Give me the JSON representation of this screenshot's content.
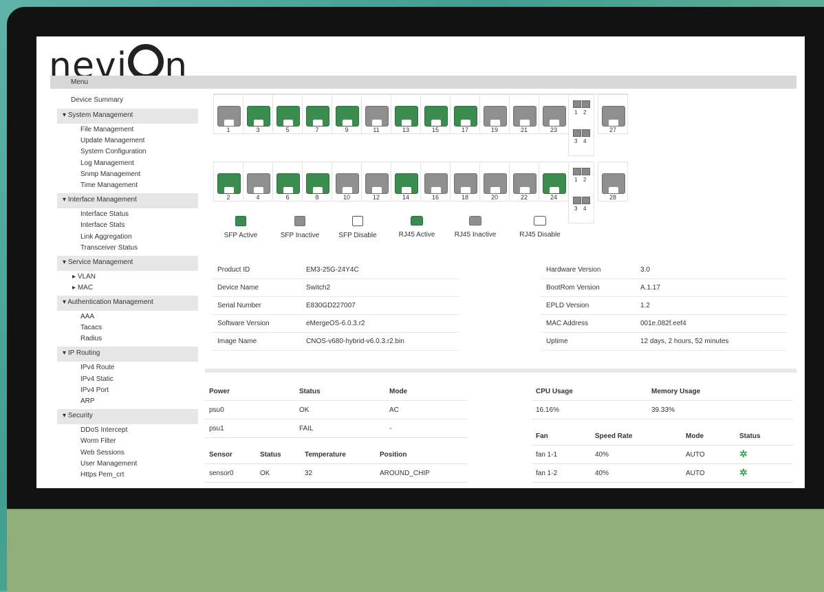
{
  "brand": {
    "logo_pre": "nevi",
    "logo_post": "n",
    "accent": "#3a8c4f",
    "inactive": "#8f8f8f"
  },
  "menu": {
    "label": "Menu"
  },
  "sidebar": {
    "top": "Device Summary",
    "groups": [
      {
        "label": "System Management",
        "items": [
          "File Management",
          "Update Management",
          "System Configuration",
          "Log Management",
          "Snmp Management",
          "Time Management"
        ]
      },
      {
        "label": "Interface Management",
        "items": [
          "Interface Status",
          "Interface Stats",
          "Link Aggregation",
          "Transceiver Status"
        ]
      },
      {
        "label": "Service Management",
        "items": [
          "VLAN",
          "MAC"
        ]
      },
      {
        "label": "Authentication Management",
        "items": [
          "AAA",
          "Tacacs",
          "Radius"
        ]
      },
      {
        "label": "IP Routing",
        "items": [
          "IPv4 Route",
          "IPv4 Static",
          "IPv4 Port",
          "ARP"
        ]
      },
      {
        "label": "Security",
        "items": [
          "DDoS Intercept",
          "Worm Filter",
          "Web Sessions",
          "User Management",
          "Https Pem_crt"
        ]
      }
    ]
  },
  "ports": {
    "top": [
      {
        "n": "1",
        "s": "inactive"
      },
      {
        "n": "3",
        "s": "active"
      },
      {
        "n": "5",
        "s": "active"
      },
      {
        "n": "7",
        "s": "active"
      },
      {
        "n": "9",
        "s": "active"
      },
      {
        "n": "11",
        "s": "inactive"
      },
      {
        "n": "13",
        "s": "active"
      },
      {
        "n": "15",
        "s": "active"
      },
      {
        "n": "17",
        "s": "active"
      },
      {
        "n": "19",
        "s": "inactive"
      },
      {
        "n": "21",
        "s": "inactive"
      },
      {
        "n": "23",
        "s": "inactive"
      }
    ],
    "bottom": [
      {
        "n": "2",
        "s": "active"
      },
      {
        "n": "4",
        "s": "inactive"
      },
      {
        "n": "6",
        "s": "active"
      },
      {
        "n": "8",
        "s": "active"
      },
      {
        "n": "10",
        "s": "inactive"
      },
      {
        "n": "12",
        "s": "inactive"
      },
      {
        "n": "14",
        "s": "active"
      },
      {
        "n": "16",
        "s": "inactive"
      },
      {
        "n": "18",
        "s": "inactive"
      },
      {
        "n": "20",
        "s": "inactive"
      },
      {
        "n": "22",
        "s": "inactive"
      },
      {
        "n": "24",
        "s": "active"
      }
    ],
    "qsfp_labels": [
      "1",
      "2",
      "3",
      "4"
    ],
    "top_end": "27",
    "bottom_end": "28"
  },
  "legend": [
    "SFP Active",
    "SFP Inactive",
    "SFP Disable",
    "RJ45 Active",
    "RJ45 Inactive",
    "RJ45 Disable"
  ],
  "device_info_left": [
    {
      "k": "Product ID",
      "v": "EM3-25G-24Y4C"
    },
    {
      "k": "Device Name",
      "v": "Switch2"
    },
    {
      "k": "Serial Number",
      "v": "E830GD227007"
    },
    {
      "k": "Software Version",
      "v": "eMergeOS-6.0.3.r2"
    },
    {
      "k": "Image Name",
      "v": "CNOS-v680-hybrid-v6.0.3.r2.bin"
    }
  ],
  "device_info_right": [
    {
      "k": "Hardware Version",
      "v": "3.0"
    },
    {
      "k": "BootRom Version",
      "v": "A.1.17"
    },
    {
      "k": "EPLD Version",
      "v": "1.2"
    },
    {
      "k": "MAC Address",
      "v": "001e.082f.eef4"
    },
    {
      "k": "Uptime",
      "v": "12 days, 2 hours, 52 minutes"
    }
  ],
  "power": {
    "headers": [
      "Power",
      "Status",
      "Mode"
    ],
    "rows": [
      [
        "psu0",
        "OK",
        "AC"
      ],
      [
        "psu1",
        "FAIL",
        "-"
      ]
    ]
  },
  "sensor": {
    "headers": [
      "Sensor",
      "Status",
      "Temperature",
      "Position"
    ],
    "rows": [
      [
        "sensor0",
        "OK",
        "32",
        "AROUND_CHIP"
      ]
    ]
  },
  "usage": {
    "headers": [
      "CPU Usage",
      "Memory Usage"
    ],
    "values": [
      "16.16%",
      "39.33%"
    ]
  },
  "fan": {
    "headers": [
      "Fan",
      "Speed Rate",
      "Mode",
      "Status"
    ],
    "rows": [
      [
        "fan 1-1",
        "40%",
        "AUTO"
      ],
      [
        "fan 1-2",
        "40%",
        "AUTO"
      ]
    ]
  }
}
